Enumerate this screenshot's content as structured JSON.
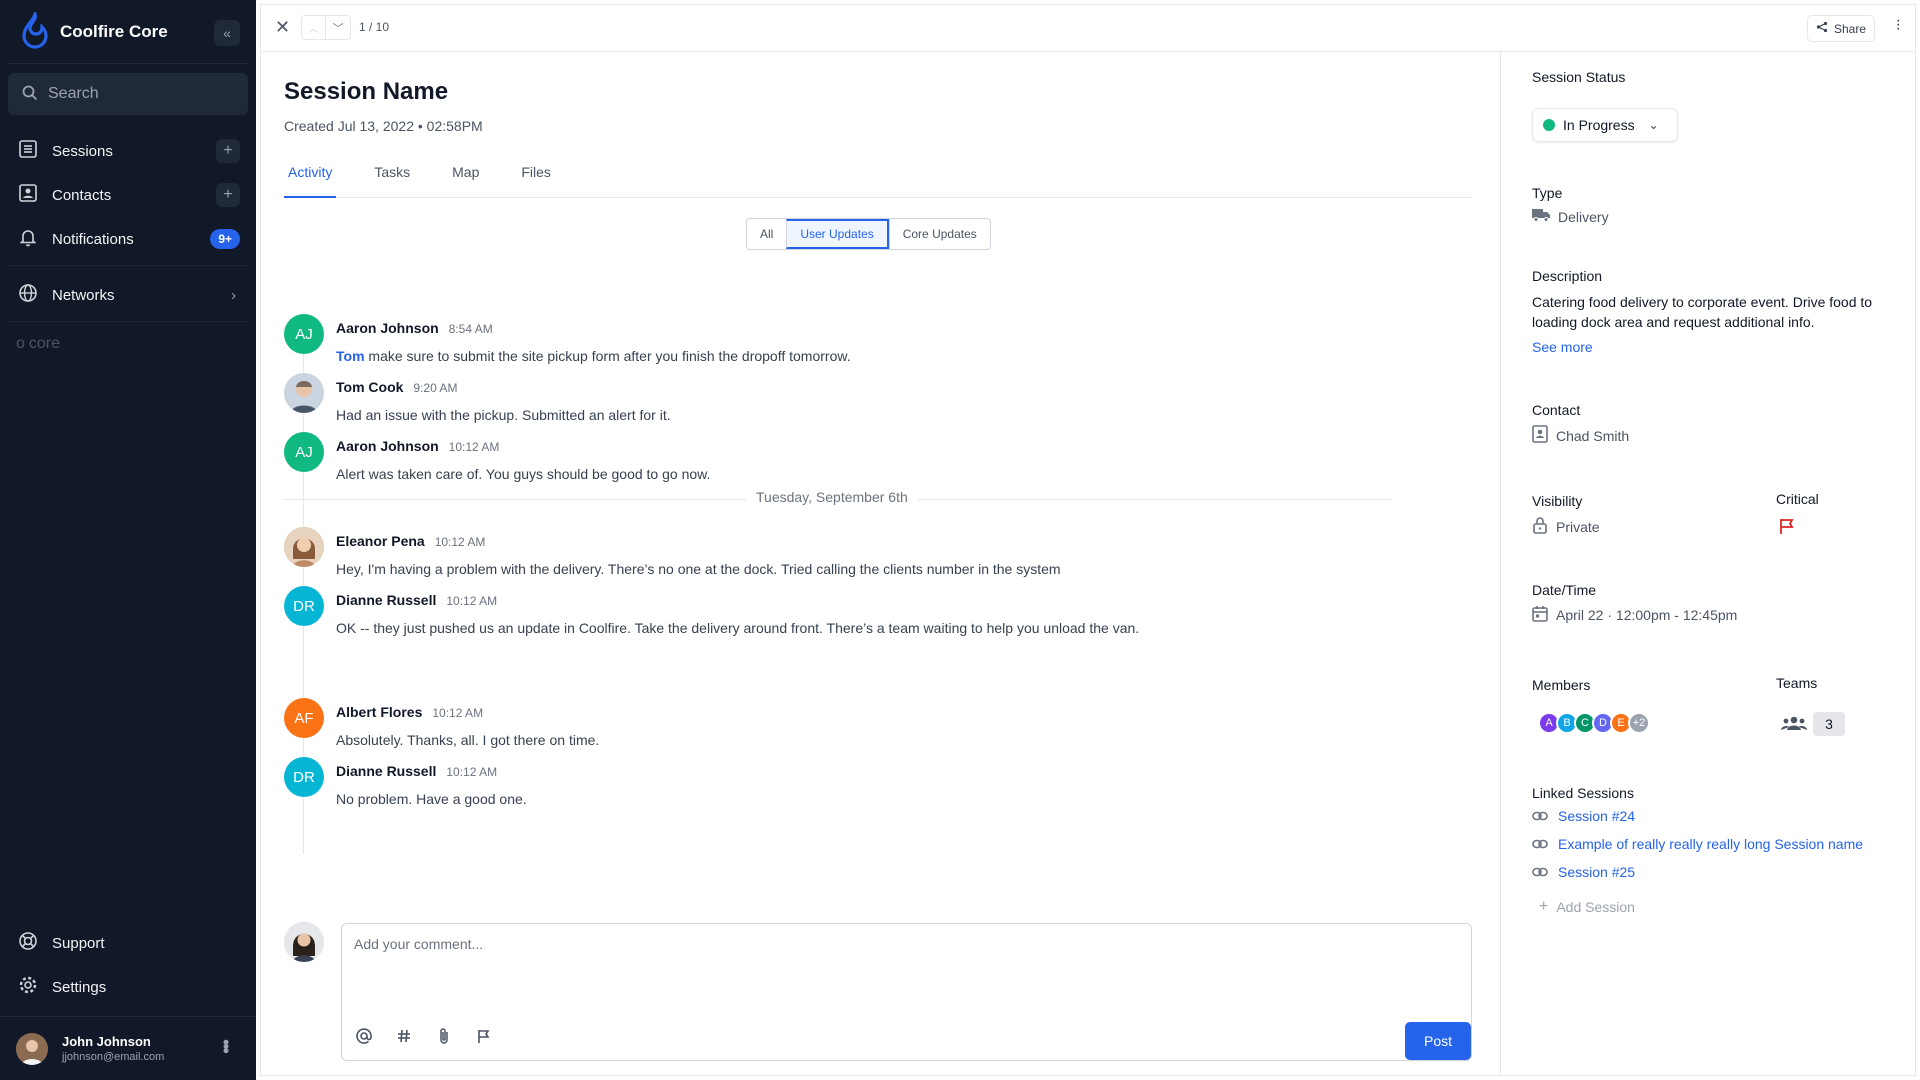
{
  "app": {
    "name": "Coolfire Core",
    "core_mark": "core"
  },
  "search": {
    "placeholder": "Search"
  },
  "sidebar": {
    "items": [
      {
        "label": "Sessions"
      },
      {
        "label": "Contacts"
      },
      {
        "label": "Notifications",
        "badge": "9+"
      },
      {
        "label": "Networks"
      }
    ],
    "bottom": [
      {
        "label": "Support"
      },
      {
        "label": "Settings"
      }
    ],
    "user": {
      "name": "John Johnson",
      "email": "jjohnson@email.com"
    }
  },
  "topbar": {
    "pager": "1 / 10",
    "share_label": "Share"
  },
  "session": {
    "title": "Session Name",
    "created": "Created Jul 13, 2022 • 02:58PM",
    "tabs": [
      {
        "label": "Activity"
      },
      {
        "label": "Tasks"
      },
      {
        "label": "Map"
      },
      {
        "label": "Files"
      }
    ],
    "filters": [
      {
        "label": "All"
      },
      {
        "label": "User Updates"
      },
      {
        "label": "Core Updates"
      }
    ]
  },
  "feed": {
    "messages": [
      {
        "initials": "AJ",
        "author": "Aaron Johnson",
        "time": "8:54 AM",
        "mention": "Tom",
        "text": " make sure to submit the site pickup form after you finish the dropoff tomorrow."
      },
      {
        "initials": "",
        "author": "Tom Cook",
        "time": "9:20 AM",
        "mention": "",
        "text": "Had an issue with the pickup. Submitted an alert for it."
      },
      {
        "initials": "AJ",
        "author": "Aaron Johnson",
        "time": "10:12 AM",
        "mention": "",
        "text": "Alert was taken care of. You guys should be good to go now."
      },
      {
        "initials": "",
        "author": "Eleanor Pena",
        "time": "10:12 AM",
        "mention": "",
        "text": "Hey, I'm having a problem with the delivery. There’s no one at the dock. Tried calling the clients number in the system"
      },
      {
        "initials": "DR",
        "author": "Dianne Russell",
        "time": "10:12 AM",
        "mention": "",
        "text": "OK -- they just pushed us an update in Coolfire. Take the delivery around front. There’s a team waiting to help you unload the van."
      },
      {
        "initials": "AF",
        "author": "Albert Flores",
        "time": "10:12 AM",
        "mention": "",
        "text": "Absolutely. Thanks, all. I got there on time."
      },
      {
        "initials": "DR",
        "author": "Dianne Russell",
        "time": "10:12 AM",
        "mention": "",
        "text": "No problem. Have a good one."
      }
    ],
    "date_separator": "Tuesday, September 6th"
  },
  "composer": {
    "placeholder": "Add your comment...",
    "post_label": "Post"
  },
  "panel": {
    "status_label": "Session Status",
    "status_value": "In Progress",
    "type_label": "Type",
    "type_value": "Delivery",
    "description_label": "Description",
    "description_text": "Catering food delivery to corporate event. Drive food to loading dock area and request additional info.",
    "see_more": "See more",
    "contact_label": "Contact",
    "contact_value": "Chad Smith",
    "visibility_label": "Visibility",
    "visibility_value": "Private",
    "critical_label": "Critical",
    "datetime_label": "Date/Time",
    "datetime_value": "April 22 · 12:00pm - 12:45pm",
    "members_label": "Members",
    "members": [
      "A",
      "B",
      "C",
      "D",
      "E"
    ],
    "members_more": "+2",
    "teams_label": "Teams",
    "teams_count": "3",
    "linked_label": "Linked Sessions",
    "linked": [
      {
        "label": "Session #24"
      },
      {
        "label": "Example of really really really long Session name"
      },
      {
        "label": "Session #25"
      }
    ],
    "add_session": "Add Session"
  },
  "colors": {
    "accent": "#2563eb",
    "sidebar_bg": "#111827",
    "status_green": "#10b981",
    "critical_red": "#dc2626"
  }
}
